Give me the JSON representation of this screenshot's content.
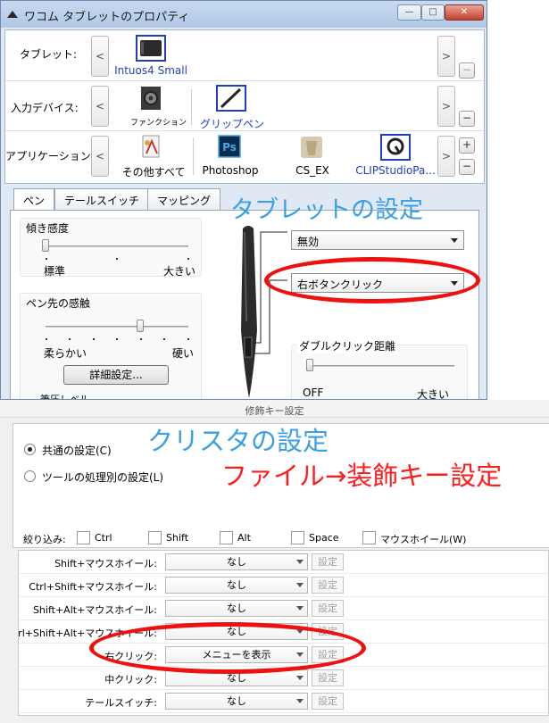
{
  "window1": {
    "title": "ワコム タブレットのプロパティ",
    "caption_buttons": {
      "minimize": "—",
      "maximize": "□",
      "close": "✕"
    }
  },
  "devices": {
    "tablet": {
      "label": "タブレット:",
      "items": [
        {
          "label": "Intuos4 Small",
          "icon": "tablet-icon"
        }
      ],
      "minus": "−"
    },
    "input": {
      "label": "入力デバイス:",
      "items": [
        {
          "label": "ファンクション",
          "icon": "function-keys-icon"
        },
        {
          "label": "グリップペン",
          "icon": "grip-pen-icon"
        }
      ],
      "minus": "−"
    },
    "application": {
      "label": "アプリケーション:",
      "items": [
        {
          "label": "その他すべて",
          "icon": "all-apps-icon"
        },
        {
          "label": "Photoshop",
          "icon": "photoshop-icon"
        },
        {
          "label": "CS_EX",
          "icon": "cs-ex-icon"
        },
        {
          "label": "CLIPStudioPa...",
          "icon": "clip-studio-icon"
        }
      ],
      "plus": "+",
      "minus": "−"
    },
    "arrows": {
      "left": "<",
      "right": ">"
    }
  },
  "tabs": [
    "ペン",
    "テールスイッチ",
    "マッピング"
  ],
  "pen_settings": {
    "tilt": {
      "title": "傾き感度",
      "min_label": "標準",
      "max_label": "大きい",
      "level": 0.0
    },
    "tip_feel": {
      "title": "ペン先の感触",
      "min_label": "柔らかい",
      "max_label": "硬い",
      "level": 0.66,
      "details_button": "詳細設定..."
    },
    "pressure_partial": "筆圧レベル",
    "upper_button": "無効",
    "lower_button": "右ボタンクリック",
    "double_click": {
      "title": "ダブルクリック距離",
      "min_label": "OFF",
      "max_label": "大きい",
      "level": 0.0
    }
  },
  "annotations": {
    "tablet_settings": "タブレットの設定",
    "clip_studio_settings": "クリスタの設定",
    "file_menu_path": "ファイル→装飾キー設定"
  },
  "window2": {
    "title": "修飾キー設定",
    "radio_common": "共通の設定(C)",
    "radio_per_tool": "ツールの処理別の設定(L)",
    "filter_label": "絞り込み:",
    "filters": [
      "Ctrl",
      "Shift",
      "Alt",
      "Space",
      "マウスホイール(W)"
    ],
    "rows": [
      {
        "key": "Shift+マウスホイール:",
        "value": "なし",
        "button": "設定"
      },
      {
        "key": "Ctrl+Shift+マウスホイール:",
        "value": "なし",
        "button": "設定"
      },
      {
        "key": "Shift+Alt+マウスホイール:",
        "value": "なし",
        "button": "設定"
      },
      {
        "key": "Ctrl+Shift+Alt+マウスホイール:",
        "value": "なし",
        "button": "設定"
      },
      {
        "key": "右クリック:",
        "value": "メニューを表示",
        "button": "設定"
      },
      {
        "key": "中クリック:",
        "value": "なし",
        "button": "設定"
      },
      {
        "key": "テールスイッチ:",
        "value": "なし",
        "button": "設定"
      }
    ]
  },
  "colors": {
    "annotation_blue": "#3aa0e4",
    "annotation_red": "#ff1c1c",
    "highlight_ellipse": "#ee1111",
    "selected_device_text": "#1f3fbf"
  }
}
